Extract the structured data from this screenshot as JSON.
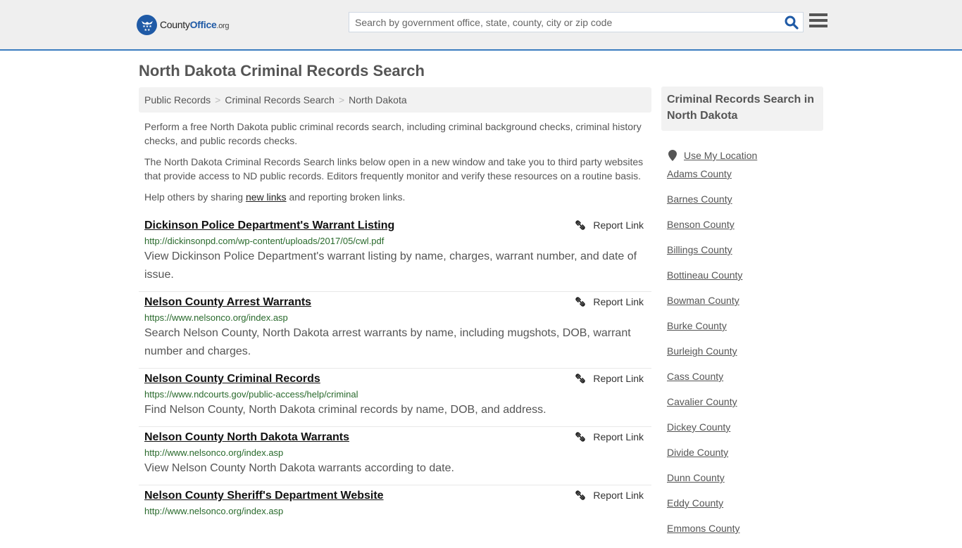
{
  "header": {
    "logo": {
      "prefix": "County",
      "brand": "Office",
      "tld": ".org"
    },
    "search": {
      "placeholder": "Search by government office, state, county, city or zip code",
      "value": ""
    },
    "icons": {
      "search": "search-icon",
      "menu": "hamburger-menu-icon"
    }
  },
  "page": {
    "title": "North Dakota Criminal Records Search",
    "breadcrumb": [
      {
        "label": "Public Records"
      },
      {
        "label": "Criminal Records Search"
      },
      {
        "label": "North Dakota"
      }
    ],
    "breadcrumb_separator": ">",
    "intro": {
      "p1": "Perform a free North Dakota public criminal records search, including criminal background checks, criminal history checks, and public records checks.",
      "p2": "The North Dakota Criminal Records Search links below open in a new window and take you to third party websites that provide access to ND public records. Editors frequently monitor and verify these resources on a routine basis.",
      "p3_before": "Help others by sharing ",
      "p3_link": "new links",
      "p3_after": " and reporting broken links."
    }
  },
  "results": [
    {
      "title": "Dickinson Police Department's Warrant Listing",
      "url": "http://dickinsonpd.com/wp-content/uploads/2017/05/cwl.pdf",
      "description": "View Dickinson Police Department's warrant listing by name, charges, warrant number, and date of issue.",
      "report_label": "Report Link"
    },
    {
      "title": "Nelson County Arrest Warrants",
      "url": "https://www.nelsonco.org/index.asp",
      "description": "Search Nelson County, North Dakota arrest warrants by name, including mugshots, DOB, warrant number and charges.",
      "report_label": "Report Link"
    },
    {
      "title": "Nelson County Criminal Records",
      "url": "https://www.ndcourts.gov/public-access/help/criminal",
      "description": "Find Nelson County, North Dakota criminal records by name, DOB, and address.",
      "report_label": "Report Link"
    },
    {
      "title": "Nelson County North Dakota Warrants",
      "url": "http://www.nelsonco.org/index.asp",
      "description": "View Nelson County North Dakota warrants according to date.",
      "report_label": "Report Link"
    },
    {
      "title": "Nelson County Sheriff's Department Website",
      "url": "http://www.nelsonco.org/index.asp",
      "description": "",
      "report_label": "Report Link"
    }
  ],
  "sidebar": {
    "heading": "Criminal Records Search in North Dakota",
    "use_location": "Use My Location",
    "counties": [
      "Adams County",
      "Barnes County",
      "Benson County",
      "Billings County",
      "Bottineau County",
      "Bowman County",
      "Burke County",
      "Burleigh County",
      "Cass County",
      "Cavalier County",
      "Dickey County",
      "Divide County",
      "Dunn County",
      "Eddy County",
      "Emmons County"
    ]
  },
  "colors": {
    "brand_blue": "#1f5aa6",
    "header_border": "#3b7cc0",
    "url_green": "#28692b",
    "header_bg": "#efefef"
  }
}
